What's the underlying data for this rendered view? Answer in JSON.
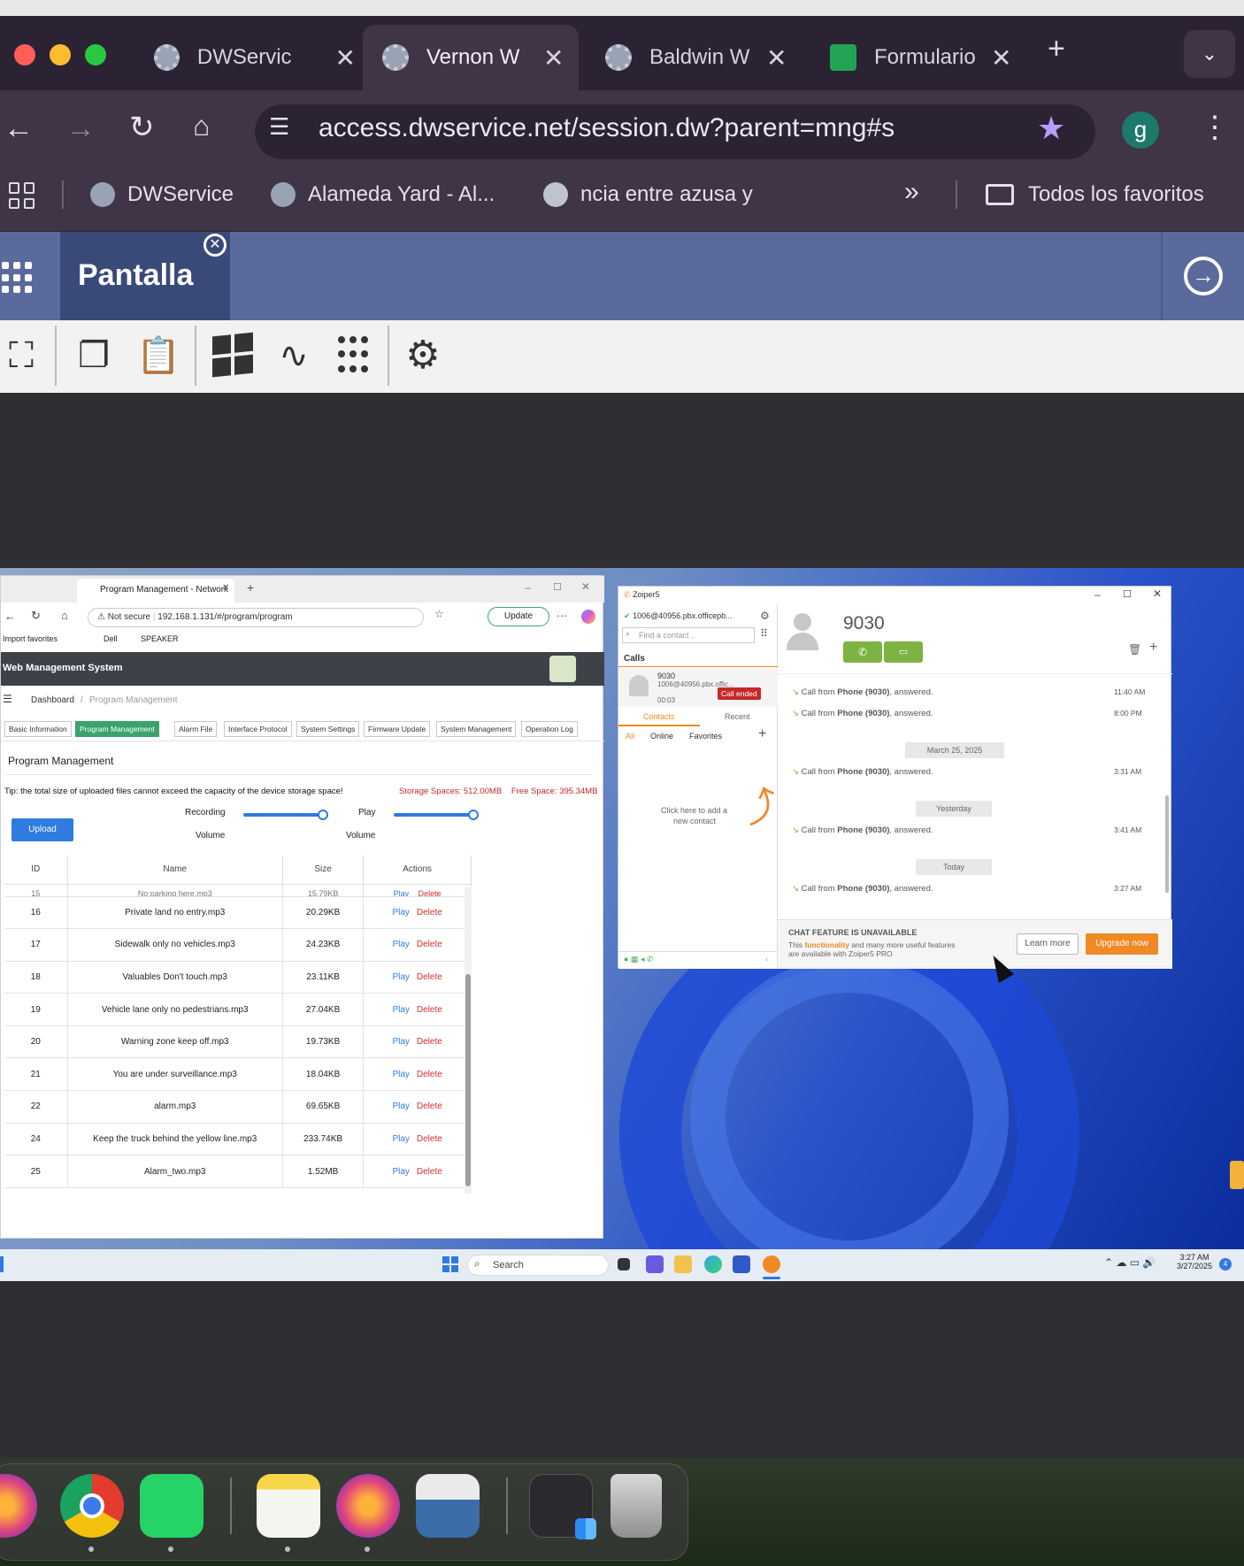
{
  "browser": {
    "tabs": [
      {
        "title": "DWServic",
        "active": false
      },
      {
        "title": "Vernon W",
        "active": true
      },
      {
        "title": "Baldwin W",
        "active": false
      },
      {
        "title": "Formulario",
        "active": false
      }
    ],
    "url": "access.dwservice.net/session.dw?parent=mng#s",
    "profile_initial": "g",
    "bookmarks": [
      "DWService",
      "Alameda Yard - Al...",
      "ncia entre azusa y"
    ],
    "all_bookmarks": "Todos los favoritos",
    "more": "»"
  },
  "dwservice": {
    "section_title": "Pantalla"
  },
  "remote_browser": {
    "tab_title": "Program Management - Network",
    "not_secure": "Not secure",
    "address": "192.168.1.131/#/program/program",
    "update_label": "Update",
    "favorites": [
      "Import favorites",
      "Dell",
      "SPEAKER"
    ],
    "app_title": "Web Management System",
    "breadcrumb_home": "Dashboard",
    "breadcrumb_current": "Program Management",
    "tabs": [
      "Basic Information",
      "Program Management",
      "Alarm File",
      "Interface Protocol",
      "System Settings",
      "Firmware Update",
      "System Management",
      "Operation Log"
    ],
    "page_title": "Program Management",
    "tip": "Tip: the total size of uploaded files cannot exceed the capacity of the device storage space!",
    "storage": "Storage Spaces: 512.00MB",
    "free_space": "Free Space: 395.34MB",
    "upload_label": "Upload",
    "recording_label_1": "Recording",
    "recording_label_2": "Volume",
    "play_label_1": "Play",
    "play_label_2": "Volume",
    "recording_volume": 1.0,
    "play_volume": 1.0,
    "columns": [
      "ID",
      "Name",
      "Size",
      "Actions"
    ],
    "action_play": "Play",
    "action_delete": "Delete",
    "partial_row": {
      "id": "15",
      "name": "No parking here.mp3",
      "size": "15.79KB"
    },
    "rows": [
      {
        "id": "16",
        "name": "Private land no entry.mp3",
        "size": "20.29KB"
      },
      {
        "id": "17",
        "name": "Sidewalk only no vehicles.mp3",
        "size": "24.23KB"
      },
      {
        "id": "18",
        "name": "Valuables Don't touch.mp3",
        "size": "23.11KB"
      },
      {
        "id": "19",
        "name": "Vehicle lane only no pedestrians.mp3",
        "size": "27.04KB"
      },
      {
        "id": "20",
        "name": "Warning zone keep off.mp3",
        "size": "19.73KB"
      },
      {
        "id": "21",
        "name": "You are under surveillance.mp3",
        "size": "18.04KB"
      },
      {
        "id": "22",
        "name": "alarm.mp3",
        "size": "69.65KB"
      },
      {
        "id": "24",
        "name": "Keep the truck behind the yellow line.mp3",
        "size": "233.74KB"
      },
      {
        "id": "25",
        "name": "Alarm_two.mp3",
        "size": "1.52MB"
      }
    ]
  },
  "zoiper": {
    "app_name": "Zoiper5",
    "account": "1006@40956.pbx.officepb...",
    "search_placeholder": "Find a contact ..",
    "calls_header": "Calls",
    "call_number": "9030",
    "call_detail": "1006@40956.pbx.offic...",
    "call_duration": "00:03",
    "call_status": "Call ended",
    "tab_contacts": "Contacts",
    "tab_recent": "Recent",
    "filter_all": "All",
    "filter_online": "Online",
    "filter_favorites": "Favorites",
    "add_contact_hint_1": "Click here to add a",
    "add_contact_hint_2": "new contact",
    "contact_name": "9030",
    "log": [
      {
        "text_pre": "Call from ",
        "bold": "Phone (9030)",
        "text_post": ", answered.",
        "time": "11:40 AM"
      },
      {
        "text_pre": "Call from ",
        "bold": "Phone (9030)",
        "text_post": ", answered.",
        "time": "8:00 PM"
      },
      {
        "date": "March 25, 2025"
      },
      {
        "text_pre": "Call from ",
        "bold": "Phone (9030)",
        "text_post": ", answered.",
        "time": "3:31 AM"
      },
      {
        "date": "Yesterday"
      },
      {
        "text_pre": "Call from ",
        "bold": "Phone (9030)",
        "text_post": ", answered.",
        "time": "3:41 AM"
      },
      {
        "date": "Today"
      },
      {
        "text_pre": "Call from ",
        "bold": "Phone (9030)",
        "text_post": ", answered.",
        "time": "3:27 AM"
      }
    ],
    "chat_title": "CHAT FEATURE IS UNAVAILABLE",
    "chat_line1_pre": "This ",
    "chat_line1_bold": "functionality",
    "chat_line1_post": " and many more useful features",
    "chat_line2": "are available with Zoiper5 PRO",
    "learn_more": "Learn more",
    "upgrade_now": "Upgrade now"
  },
  "taskbar": {
    "search_label": "Search",
    "time": "3:27 AM",
    "date": "3/27/2025",
    "badge": "4"
  }
}
